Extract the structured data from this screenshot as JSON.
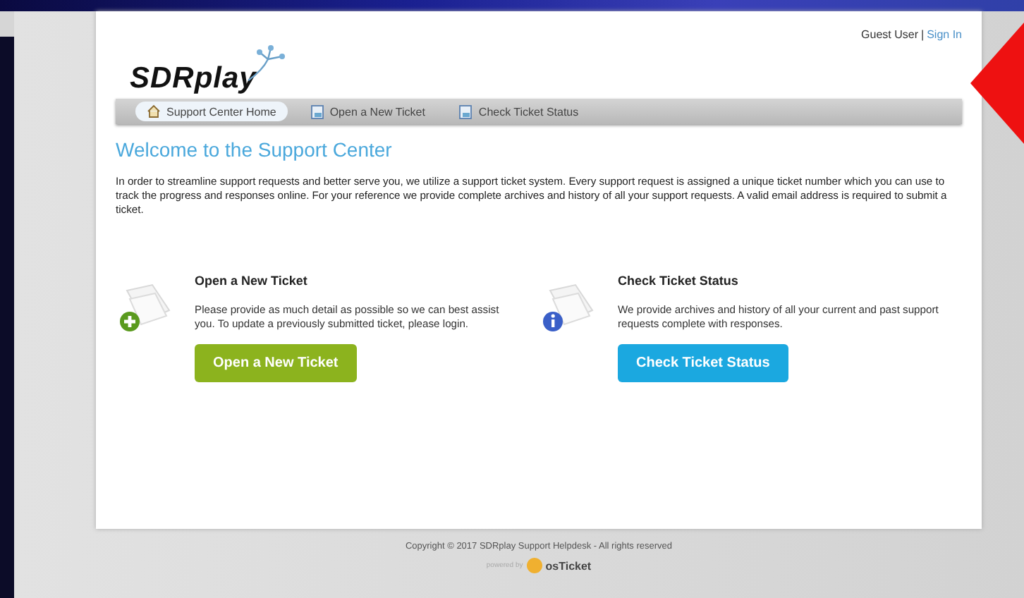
{
  "user_bar": {
    "user": "Guest User",
    "separator": "|",
    "sign_in": "Sign In"
  },
  "logo": {
    "text": "SDRplay"
  },
  "nav": [
    {
      "label": "Support Center Home",
      "kind": "home",
      "selected": true
    },
    {
      "label": "Open a New Ticket",
      "kind": "page",
      "selected": false
    },
    {
      "label": "Check Ticket Status",
      "kind": "page",
      "selected": false
    }
  ],
  "welcome": {
    "title": "Welcome to the Support Center",
    "body": "In order to streamline support requests and better serve you, we utilize a support ticket system. Every support request is assigned a unique ticket number which you can use to track the progress and responses online. For your reference we provide complete archives and history of all your support requests. A valid email address is required to submit a ticket."
  },
  "actions": [
    {
      "kind": "open",
      "title": "Open a New Ticket",
      "description": "Please provide as much detail as possible so we can best assist you. To update a previously submitted ticket, please login.",
      "button": "Open a New Ticket"
    },
    {
      "kind": "check",
      "title": "Check Ticket Status",
      "description": "We provide archives and history of all your current and past support requests complete with responses.",
      "button": "Check Ticket Status"
    }
  ],
  "footer": {
    "copyright": "Copyright © 2017 SDRplay Support Helpdesk - All rights reserved",
    "powered_by": "powered by",
    "brand": "osTicket"
  }
}
